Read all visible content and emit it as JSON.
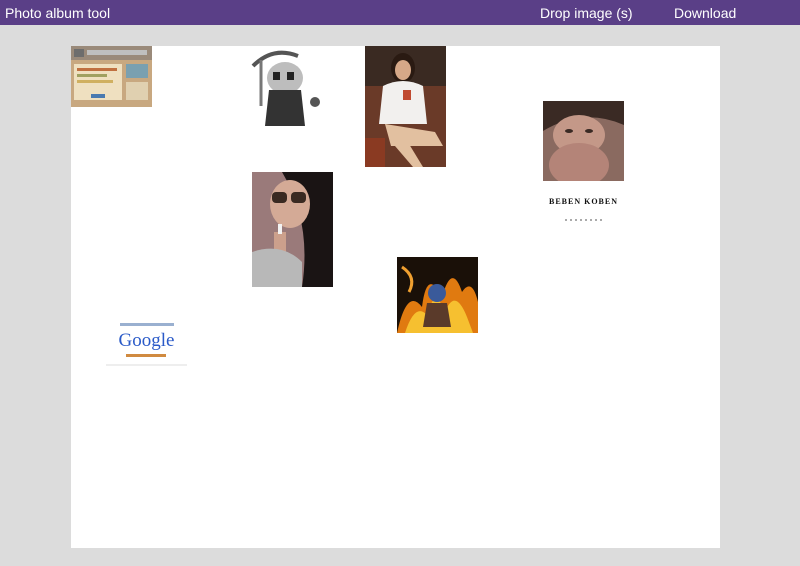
{
  "header": {
    "title": "Photo album tool",
    "drop_label": "Drop image (s)",
    "download_label": "Download"
  },
  "colors": {
    "header_bg": "#5a3f87",
    "page_bg": "#dcdcdc",
    "canvas_bg": "#ffffff"
  },
  "album": {
    "photos": [
      {
        "name": "photo-screenshot-thumbnail"
      },
      {
        "name": "photo-grim-reaper-cartoon"
      },
      {
        "name": "photo-girl-in-white-uniform"
      },
      {
        "name": "photo-woman-portrait"
      },
      {
        "name": "photo-beben-koben-text"
      },
      {
        "name": "photo-girl-with-sunglasses-lighter"
      },
      {
        "name": "photo-flames-artwork"
      },
      {
        "name": "photo-google-logo"
      }
    ],
    "text_photo_label": "BEBEN KOBEN",
    "google_logo_text": "Google"
  }
}
